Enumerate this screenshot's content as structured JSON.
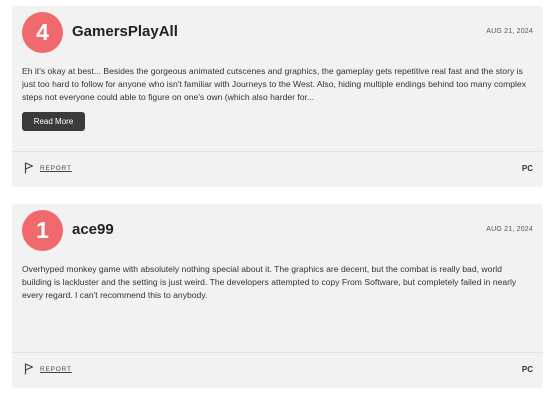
{
  "reviews": [
    {
      "score": "4",
      "username": "GamersPlayAll",
      "date": "AUG 21, 2024",
      "text": "Eh it's okay at best... Besides the gorgeous animated cutscenes and graphics, the gameplay gets repetitive real fast and the story is just too hard to follow for anyone who isn't familiar with Journeys to the West. Also, hiding multiple endings behind too many complex steps not everyone could able to figure on one's own (which also harder for...",
      "read_more_label": "Read More",
      "report_label": "REPORT",
      "platform": "PC",
      "score_color": "#f06a6d"
    },
    {
      "score": "1",
      "username": "ace99",
      "date": "AUG 21, 2024",
      "text": "Overhyped monkey game with absolutely nothing special about it. The graphics are decent, but the combat is really bad, world building is lackluster and the setting is just weird. The developers attempted to copy From Software, but completely failed in nearly every regard. I can't recommend this to anybody.",
      "report_label": "REPORT",
      "platform": "PC",
      "score_color": "#f06a6d"
    }
  ]
}
